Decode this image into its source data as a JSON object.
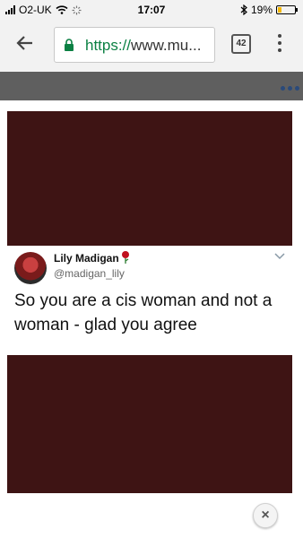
{
  "status": {
    "carrier": "O2-UK",
    "time": "17:07",
    "battery": "19%",
    "battery_level": 0.19
  },
  "browser": {
    "url_scheme": "https://",
    "url_rest": "www.mu...",
    "tab_count": "42",
    "back_icon": "arrow-left-icon",
    "menu_icon": "more-vert-icon"
  },
  "tweet": {
    "display_name": "Lily Madigan",
    "emoji": "rose",
    "handle": "@madigan_lily",
    "text": "So you are a cis woman and not a woman - glad you agree"
  },
  "lightbox": {
    "close_label": "×"
  }
}
